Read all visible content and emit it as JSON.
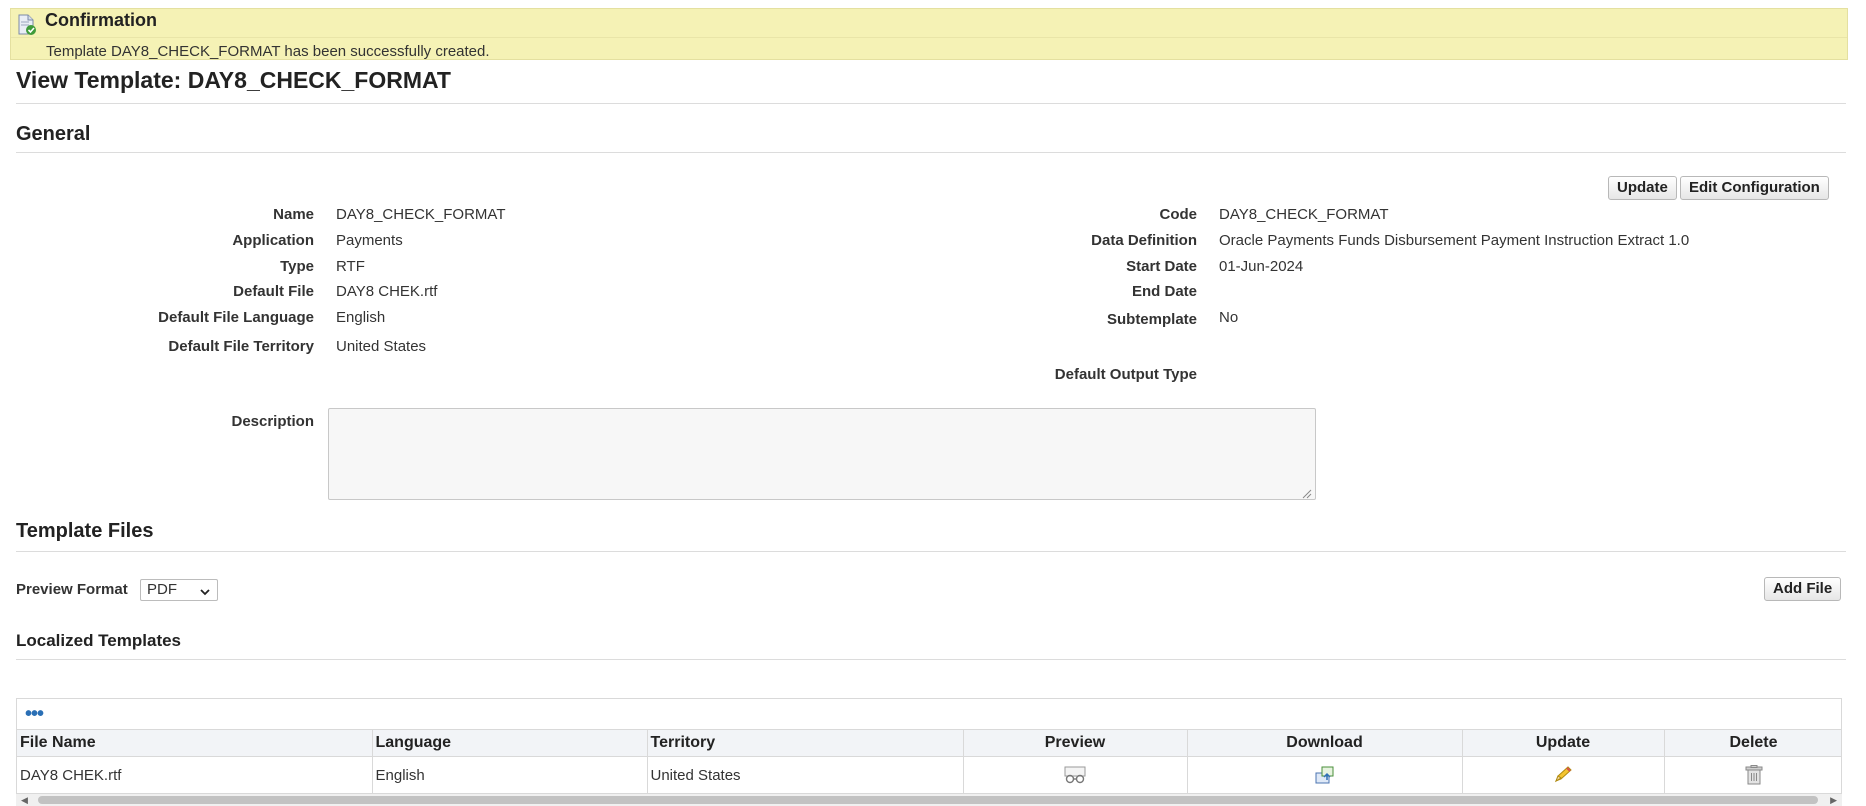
{
  "confirmation": {
    "icon": "document-check-icon",
    "title": "Confirmation",
    "message": "Template DAY8_CHECK_FORMAT has been successfully created."
  },
  "page_title": "View Template: DAY8_CHECK_FORMAT",
  "general": {
    "heading": "General",
    "buttons": {
      "update": "Update",
      "edit_configuration": "Edit Configuration"
    },
    "left": [
      {
        "label": "Name",
        "value": "DAY8_CHECK_FORMAT"
      },
      {
        "label": "Application",
        "value": "Payments"
      },
      {
        "label": "Type",
        "value": "RTF"
      },
      {
        "label": "Default File",
        "value": "DAY8 CHEK.rtf"
      },
      {
        "label": "Default File Language",
        "value": "English"
      },
      {
        "label": "Default File Territory",
        "value": "United States"
      }
    ],
    "right": [
      {
        "label": "Code",
        "value": "DAY8_CHECK_FORMAT"
      },
      {
        "label": "Data Definition",
        "value": "Oracle Payments Funds Disbursement Payment Instruction Extract 1.0"
      },
      {
        "label": "Start Date",
        "value": "01-Jun-2024"
      },
      {
        "label": "End Date",
        "value": ""
      },
      {
        "label": "Subtemplate",
        "value": "No"
      },
      {
        "label": "Default Output Type",
        "value": ""
      }
    ],
    "description_label": "Description",
    "description_value": ""
  },
  "template_files": {
    "heading": "Template Files",
    "preview_format_label": "Preview Format",
    "preview_format_value": "PDF",
    "add_file": "Add File"
  },
  "localized": {
    "heading": "Localized Templates",
    "more_icon": "more-dots-icon",
    "columns": [
      "File Name",
      "Language",
      "Territory",
      "Preview",
      "Download",
      "Update",
      "Delete"
    ],
    "rows": [
      {
        "file_name": "DAY8 CHEK.rtf",
        "language": "English",
        "territory": "United States",
        "preview_icon": "preview-glasses-icon",
        "download_icon": "download-icon",
        "update_icon": "pencil-icon",
        "delete_icon": "trash-icon"
      }
    ]
  }
}
